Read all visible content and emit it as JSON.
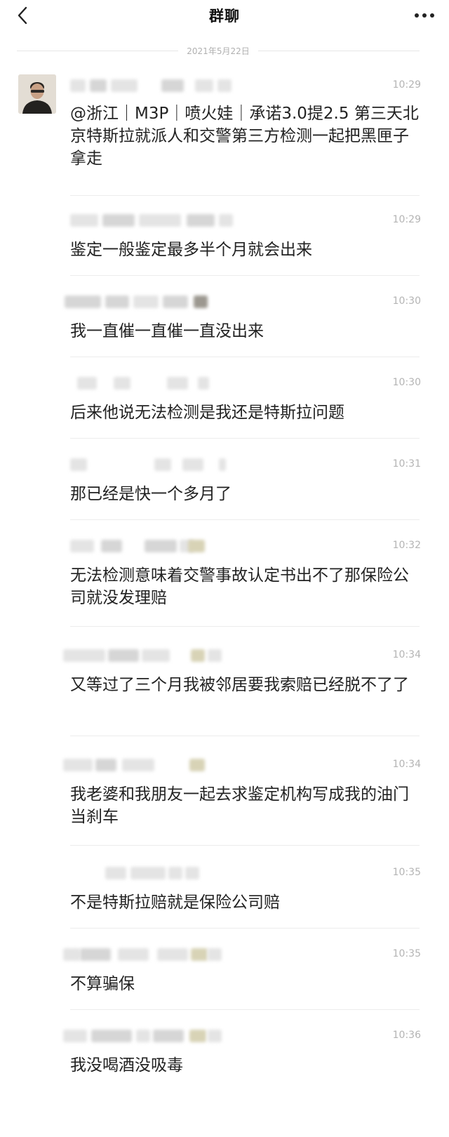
{
  "header": {
    "title": "群聊"
  },
  "date_divider": "2021年5月22日",
  "messages": [
    {
      "time": "10:29",
      "text": "@浙江｜M3P｜喷火娃｜承诺3.0提2.5 第三天北京特斯拉就派人和交警第三方检测一起把黑匣子拿走"
    },
    {
      "time": "10:29",
      "text": "鉴定一般鉴定最多半个月就会出来"
    },
    {
      "time": "10:30",
      "text": "我一直催一直催一直没出来"
    },
    {
      "time": "10:30",
      "text": "后来他说无法检测是我还是特斯拉问题"
    },
    {
      "time": "10:31",
      "text": "那已经是快一个多月了"
    },
    {
      "time": "10:32",
      "text": "无法检测意味着交警事故认定书出不了那保险公司就没发理赔"
    },
    {
      "time": "10:34",
      "text": "又等过了三个月我被邻居要我索赔已经脱不了了"
    },
    {
      "time": "10:34",
      "text": "我老婆和我朋友一起去求鉴定机构写成我的油门当刹车"
    },
    {
      "time": "10:35",
      "text": "不是特斯拉赔就是保险公司赔"
    },
    {
      "time": "10:35",
      "text": "不算骗保"
    },
    {
      "time": "10:36",
      "text": "我没喝酒没吸毒"
    }
  ]
}
